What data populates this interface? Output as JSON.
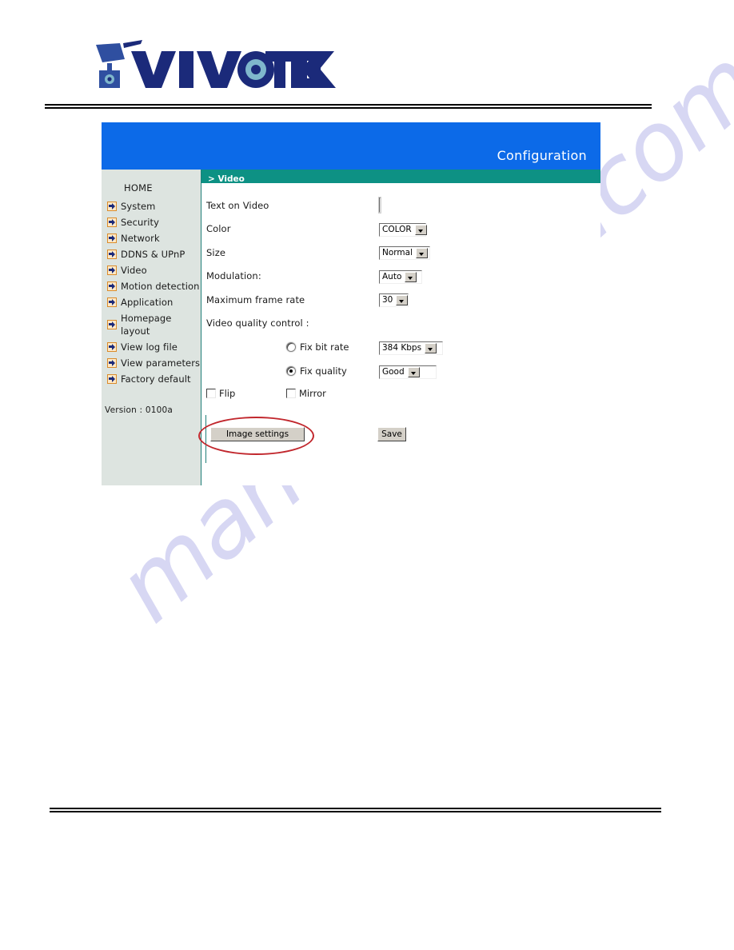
{
  "brand": {
    "logo_text": "VIVOTEK",
    "logo_colors": {
      "dark_blue": "#1b2a7a",
      "mid_blue": "#2f4fa0",
      "teal": "#3d8fa8"
    }
  },
  "header": {
    "title": "Configuration",
    "bg_color": "#0c6ae8"
  },
  "subheader": {
    "title": "> Video",
    "bg_color": "#0d9184"
  },
  "sidebar": {
    "home_label": "HOME",
    "items": [
      {
        "label": "System",
        "icon": "arrow-right-icon"
      },
      {
        "label": "Security",
        "icon": "arrow-right-icon"
      },
      {
        "label": "Network",
        "icon": "arrow-right-icon"
      },
      {
        "label": "DDNS & UPnP",
        "icon": "arrow-right-icon"
      },
      {
        "label": "Video",
        "icon": "arrow-right-icon"
      },
      {
        "label": "Motion detection",
        "icon": "arrow-right-icon"
      },
      {
        "label": "Application",
        "icon": "arrow-right-icon"
      },
      {
        "label": "Homepage layout",
        "icon": "arrow-right-icon"
      },
      {
        "label": "View log file",
        "icon": "arrow-right-icon"
      },
      {
        "label": "View parameters",
        "icon": "arrow-right-icon"
      },
      {
        "label": "Factory default",
        "icon": "arrow-right-icon"
      }
    ],
    "version": "Version : 0100a",
    "bg_color": "#dde4e0"
  },
  "form": {
    "text_on_video": {
      "label": "Text on Video",
      "value": "",
      "placeholder": ""
    },
    "color": {
      "label": "Color",
      "value": "COLOR"
    },
    "size": {
      "label": "Size",
      "value": "Normal"
    },
    "modulation": {
      "label": "Modulation:",
      "value": "Auto"
    },
    "max_frame_rate": {
      "label": "Maximum frame rate",
      "value": "30"
    },
    "video_quality_control": {
      "label": "Video quality control :",
      "fix_bit_rate": {
        "label": "Fix bit rate",
        "selected": false,
        "value": "384 Kbps"
      },
      "fix_quality": {
        "label": "Fix quality",
        "selected": true,
        "value": "Good"
      }
    },
    "flip": {
      "label": "Flip",
      "checked": false
    },
    "mirror": {
      "label": "Mirror",
      "checked": false
    }
  },
  "buttons": {
    "image_settings": "Image settings",
    "save": "Save"
  },
  "annotation": {
    "highlight_color": "#c1272d",
    "highlight_target": "Image settings"
  },
  "watermark": {
    "text": "manualshive.com",
    "color": "#c9c9ef"
  }
}
